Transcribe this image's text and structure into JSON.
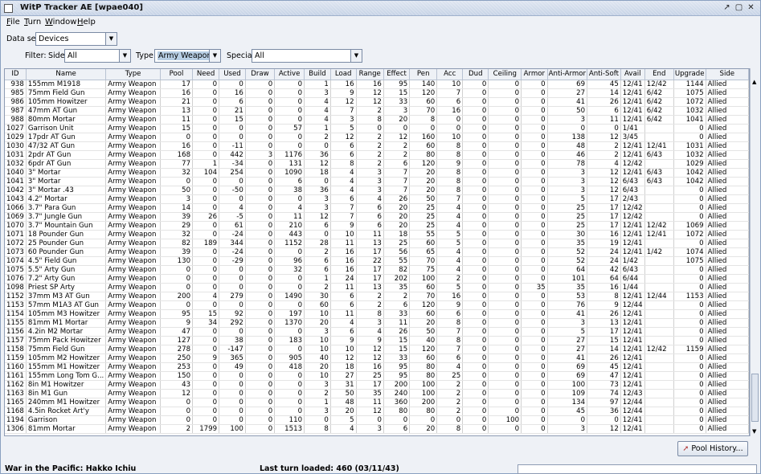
{
  "window": {
    "title": "WitP Tracker AE [wpae040]"
  },
  "menu": [
    {
      "first": "F",
      "rest": "ile"
    },
    {
      "first": "T",
      "rest": "urn"
    },
    {
      "first": "W",
      "rest": "indow"
    },
    {
      "first": "H",
      "rest": "elp"
    }
  ],
  "dataset": {
    "label": "Data set:",
    "value": "Devices"
  },
  "filter": {
    "label": "Filter:",
    "side_label": "Side:",
    "side_value": "All",
    "type_label": "Type:",
    "type_value": "Army Weapon",
    "special_label": "Special:",
    "special_value": "All"
  },
  "table": {
    "columns": [
      "ID",
      "Name",
      "Type",
      "Pool",
      "Need",
      "Used",
      "Draw",
      "Active",
      "Build",
      "Load",
      "Range",
      "Effect",
      "Pen",
      "Acc",
      "Dud",
      "Ceiling",
      "Armor",
      "Anti-Armor",
      "Anti-Soft",
      "Avail",
      "End",
      "Upgrade",
      "Side"
    ],
    "rows": [
      [
        "938",
        "155mm M1918",
        "Army Weapon",
        "17",
        "0",
        "0",
        "0",
        "0",
        "1",
        "16",
        "16",
        "95",
        "140",
        "10",
        "0",
        "0",
        "0",
        "69",
        "45",
        "12/41",
        "12/42",
        "1144",
        "Allied"
      ],
      [
        "985",
        "75mm Field Gun",
        "Army Weapon",
        "16",
        "0",
        "16",
        "0",
        "0",
        "3",
        "9",
        "12",
        "15",
        "120",
        "7",
        "0",
        "0",
        "0",
        "27",
        "14",
        "12/41",
        "6/42",
        "1075",
        "Allied"
      ],
      [
        "986",
        "105mm Howitzer",
        "Army Weapon",
        "21",
        "0",
        "6",
        "0",
        "0",
        "4",
        "12",
        "12",
        "33",
        "60",
        "6",
        "0",
        "0",
        "0",
        "41",
        "26",
        "12/41",
        "6/42",
        "1072",
        "Allied"
      ],
      [
        "987",
        "47mm AT Gun",
        "Army Weapon",
        "13",
        "0",
        "21",
        "0",
        "0",
        "4",
        "7",
        "2",
        "3",
        "70",
        "16",
        "0",
        "0",
        "0",
        "50",
        "6",
        "12/41",
        "6/42",
        "1032",
        "Allied"
      ],
      [
        "988",
        "80mm Mortar",
        "Army Weapon",
        "11",
        "0",
        "15",
        "0",
        "0",
        "4",
        "3",
        "8",
        "20",
        "8",
        "0",
        "0",
        "0",
        "0",
        "3",
        "11",
        "12/41",
        "6/42",
        "1041",
        "Allied"
      ],
      [
        "1027",
        "Garrison Unit",
        "Army Weapon",
        "15",
        "0",
        "0",
        "0",
        "57",
        "1",
        "5",
        "0",
        "0",
        "0",
        "0",
        "0",
        "0",
        "0",
        "0",
        "0",
        "1/41",
        "",
        "0",
        "Allied"
      ],
      [
        "1029",
        "17pdr AT Gun",
        "Army Weapon",
        "0",
        "0",
        "0",
        "0",
        "0",
        "2",
        "12",
        "2",
        "12",
        "160",
        "10",
        "0",
        "0",
        "0",
        "138",
        "12",
        "3/45",
        "",
        "0",
        "Allied"
      ],
      [
        "1030",
        "47/32 AT Gun",
        "Army Weapon",
        "16",
        "0",
        "-11",
        "0",
        "0",
        "0",
        "6",
        "2",
        "2",
        "60",
        "8",
        "0",
        "0",
        "0",
        "48",
        "2",
        "12/41",
        "12/41",
        "1031",
        "Allied"
      ],
      [
        "1031",
        "2pdr AT Gun",
        "Army Weapon",
        "168",
        "0",
        "442",
        "3",
        "1176",
        "36",
        "6",
        "2",
        "2",
        "80",
        "8",
        "0",
        "0",
        "0",
        "46",
        "2",
        "12/41",
        "6/43",
        "1032",
        "Allied"
      ],
      [
        "1032",
        "6pdr AT Gun",
        "Army Weapon",
        "77",
        "1",
        "-34",
        "0",
        "131",
        "12",
        "8",
        "2",
        "6",
        "120",
        "9",
        "0",
        "0",
        "0",
        "78",
        "4",
        "12/42",
        "",
        "1029",
        "Allied"
      ],
      [
        "1040",
        "3\" Mortar",
        "Army Weapon",
        "32",
        "104",
        "254",
        "0",
        "1090",
        "18",
        "4",
        "3",
        "7",
        "20",
        "8",
        "0",
        "0",
        "0",
        "3",
        "12",
        "12/41",
        "6/43",
        "1042",
        "Allied"
      ],
      [
        "1041",
        "3\" Mortar",
        "Army Weapon",
        "0",
        "0",
        "0",
        "0",
        "6",
        "0",
        "4",
        "3",
        "7",
        "20",
        "8",
        "0",
        "0",
        "0",
        "3",
        "12",
        "6/43",
        "6/43",
        "1042",
        "Allied"
      ],
      [
        "1042",
        "3\" Mortar .43",
        "Army Weapon",
        "50",
        "0",
        "-50",
        "0",
        "38",
        "36",
        "4",
        "3",
        "7",
        "20",
        "8",
        "0",
        "0",
        "0",
        "3",
        "12",
        "6/43",
        "",
        "0",
        "Allied"
      ],
      [
        "1043",
        "4.2\" Mortar",
        "Army Weapon",
        "3",
        "0",
        "0",
        "0",
        "0",
        "3",
        "6",
        "4",
        "26",
        "50",
        "7",
        "0",
        "0",
        "0",
        "5",
        "17",
        "2/43",
        "",
        "0",
        "Allied"
      ],
      [
        "1066",
        "3.7\" Para Gun",
        "Army Weapon",
        "14",
        "0",
        "4",
        "0",
        "4",
        "3",
        "7",
        "6",
        "20",
        "25",
        "4",
        "0",
        "0",
        "0",
        "25",
        "17",
        "12/42",
        "",
        "0",
        "Allied"
      ],
      [
        "1069",
        "3.7\" Jungle Gun",
        "Army Weapon",
        "39",
        "26",
        "-5",
        "0",
        "11",
        "12",
        "7",
        "6",
        "20",
        "25",
        "4",
        "0",
        "0",
        "0",
        "25",
        "17",
        "12/42",
        "",
        "0",
        "Allied"
      ],
      [
        "1070",
        "3.7\" Mountain Gun",
        "Army Weapon",
        "29",
        "0",
        "61",
        "0",
        "210",
        "6",
        "9",
        "6",
        "20",
        "25",
        "4",
        "0",
        "0",
        "0",
        "25",
        "17",
        "12/41",
        "12/42",
        "1069",
        "Allied"
      ],
      [
        "1071",
        "18 Pounder Gun",
        "Army Weapon",
        "32",
        "0",
        "-24",
        "0",
        "443",
        "0",
        "10",
        "11",
        "18",
        "55",
        "5",
        "0",
        "0",
        "0",
        "30",
        "16",
        "12/41",
        "12/41",
        "1072",
        "Allied"
      ],
      [
        "1072",
        "25 Pounder Gun",
        "Army Weapon",
        "82",
        "189",
        "344",
        "0",
        "1152",
        "28",
        "11",
        "13",
        "25",
        "60",
        "5",
        "0",
        "0",
        "0",
        "35",
        "19",
        "12/41",
        "",
        "0",
        "Allied"
      ],
      [
        "1073",
        "60 Pounder Gun",
        "Army Weapon",
        "39",
        "0",
        "-24",
        "0",
        "0",
        "2",
        "16",
        "17",
        "56",
        "65",
        "4",
        "0",
        "0",
        "0",
        "52",
        "24",
        "12/41",
        "1/42",
        "1074",
        "Allied"
      ],
      [
        "1074",
        "4.5\" Field Gun",
        "Army Weapon",
        "130",
        "0",
        "-29",
        "0",
        "96",
        "6",
        "16",
        "22",
        "55",
        "70",
        "4",
        "0",
        "0",
        "0",
        "52",
        "24",
        "1/42",
        "",
        "1075",
        "Allied"
      ],
      [
        "1075",
        "5.5\" Arty Gun",
        "Army Weapon",
        "0",
        "0",
        "0",
        "0",
        "32",
        "6",
        "16",
        "17",
        "82",
        "75",
        "4",
        "0",
        "0",
        "0",
        "64",
        "42",
        "6/43",
        "",
        "0",
        "Allied"
      ],
      [
        "1076",
        "7.2\" Arty Gun",
        "Army Weapon",
        "0",
        "0",
        "0",
        "0",
        "0",
        "1",
        "24",
        "17",
        "202",
        "100",
        "2",
        "0",
        "0",
        "0",
        "101",
        "64",
        "6/44",
        "",
        "0",
        "Allied"
      ],
      [
        "1098",
        "Priest SP Arty",
        "Army Weapon",
        "0",
        "0",
        "0",
        "0",
        "0",
        "2",
        "11",
        "13",
        "35",
        "60",
        "5",
        "0",
        "0",
        "35",
        "35",
        "16",
        "1/44",
        "",
        "0",
        "Allied"
      ],
      [
        "1152",
        "37mm M3 AT Gun",
        "Army Weapon",
        "200",
        "4",
        "279",
        "0",
        "1490",
        "30",
        "6",
        "2",
        "2",
        "70",
        "16",
        "0",
        "0",
        "0",
        "53",
        "8",
        "12/41",
        "12/44",
        "1153",
        "Allied"
      ],
      [
        "1153",
        "57mm M1A3 AT Gun",
        "Army Weapon",
        "0",
        "0",
        "0",
        "0",
        "0",
        "60",
        "6",
        "2",
        "6",
        "120",
        "9",
        "0",
        "0",
        "0",
        "76",
        "9",
        "12/44",
        "",
        "0",
        "Allied"
      ],
      [
        "1154",
        "105mm M3 Howitzer",
        "Army Weapon",
        "95",
        "15",
        "92",
        "0",
        "197",
        "10",
        "11",
        "8",
        "33",
        "60",
        "6",
        "0",
        "0",
        "0",
        "41",
        "26",
        "12/41",
        "",
        "0",
        "Allied"
      ],
      [
        "1155",
        "81mm M1 Mortar",
        "Army Weapon",
        "9",
        "34",
        "292",
        "0",
        "1370",
        "20",
        "4",
        "3",
        "11",
        "20",
        "8",
        "0",
        "0",
        "0",
        "3",
        "13",
        "12/41",
        "",
        "0",
        "Allied"
      ],
      [
        "1156",
        "4.2in M2 Mortar",
        "Army Weapon",
        "47",
        "0",
        "0",
        "0",
        "0",
        "3",
        "6",
        "4",
        "26",
        "50",
        "7",
        "0",
        "0",
        "0",
        "5",
        "17",
        "12/41",
        "",
        "0",
        "Allied"
      ],
      [
        "1157",
        "75mm Pack Howitzer",
        "Army Weapon",
        "127",
        "0",
        "38",
        "0",
        "183",
        "10",
        "9",
        "9",
        "15",
        "40",
        "8",
        "0",
        "0",
        "0",
        "27",
        "15",
        "12/41",
        "",
        "0",
        "Allied"
      ],
      [
        "1158",
        "75mm Field Gun",
        "Army Weapon",
        "278",
        "0",
        "-147",
        "0",
        "0",
        "10",
        "10",
        "12",
        "15",
        "120",
        "7",
        "0",
        "0",
        "0",
        "27",
        "14",
        "12/41",
        "12/42",
        "1159",
        "Allied"
      ],
      [
        "1159",
        "105mm M2 Howitzer",
        "Army Weapon",
        "250",
        "9",
        "365",
        "0",
        "905",
        "40",
        "12",
        "12",
        "33",
        "60",
        "6",
        "0",
        "0",
        "0",
        "41",
        "26",
        "12/41",
        "",
        "0",
        "Allied"
      ],
      [
        "1160",
        "155mm M1 Howitzer",
        "Army Weapon",
        "253",
        "0",
        "49",
        "0",
        "418",
        "20",
        "18",
        "16",
        "95",
        "80",
        "4",
        "0",
        "0",
        "0",
        "69",
        "45",
        "12/41",
        "",
        "0",
        "Allied"
      ],
      [
        "1161",
        "155mm Long Tom G...",
        "Army Weapon",
        "150",
        "0",
        "0",
        "0",
        "0",
        "10",
        "27",
        "25",
        "95",
        "80",
        "25",
        "0",
        "0",
        "0",
        "69",
        "47",
        "12/41",
        "",
        "0",
        "Allied"
      ],
      [
        "1162",
        "8in M1 Howitzer",
        "Army Weapon",
        "43",
        "0",
        "0",
        "0",
        "0",
        "3",
        "31",
        "17",
        "200",
        "100",
        "2",
        "0",
        "0",
        "0",
        "100",
        "73",
        "12/41",
        "",
        "0",
        "Allied"
      ],
      [
        "1163",
        "8in M1 Gun",
        "Army Weapon",
        "12",
        "0",
        "0",
        "0",
        "0",
        "2",
        "50",
        "35",
        "240",
        "100",
        "2",
        "0",
        "0",
        "0",
        "109",
        "74",
        "12/43",
        "",
        "0",
        "Allied"
      ],
      [
        "1165",
        "240mm M1 Howitzer",
        "Army Weapon",
        "0",
        "0",
        "0",
        "0",
        "0",
        "1",
        "48",
        "11",
        "360",
        "200",
        "2",
        "0",
        "0",
        "0",
        "134",
        "97",
        "12/44",
        "",
        "0",
        "Allied"
      ],
      [
        "1168",
        "4.5in Rocket Art'y",
        "Army Weapon",
        "0",
        "0",
        "0",
        "0",
        "0",
        "3",
        "20",
        "12",
        "80",
        "80",
        "2",
        "0",
        "0",
        "0",
        "45",
        "36",
        "12/44",
        "",
        "0",
        "Allied"
      ],
      [
        "1194",
        "Garrison",
        "Army Weapon",
        "0",
        "0",
        "0",
        "0",
        "110",
        "0",
        "5",
        "0",
        "0",
        "0",
        "0",
        "0",
        "100",
        "0",
        "0",
        "0",
        "12/41",
        "",
        "0",
        "Allied"
      ],
      [
        "1306",
        "81mm Mortar",
        "Army Weapon",
        "2",
        "1799",
        "100",
        "0",
        "1513",
        "8",
        "4",
        "3",
        "6",
        "20",
        "8",
        "0",
        "0",
        "0",
        "3",
        "12",
        "12/41",
        "",
        "0",
        "Allied"
      ]
    ]
  },
  "pool_history_button": "Pool History...",
  "status": {
    "left": "War in the Pacific: Hakko Ichiu",
    "turn": "Last turn loaded: 460 (03/11/43)"
  }
}
